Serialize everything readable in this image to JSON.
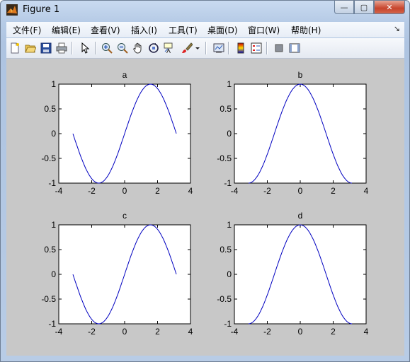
{
  "window": {
    "title": "Figure 1",
    "buttons": {
      "minimize": "—",
      "maximize": "▢",
      "close": "✕"
    }
  },
  "menubar": {
    "items": [
      "文件(F)",
      "编辑(E)",
      "查看(V)",
      "插入(I)",
      "工具(T)",
      "桌面(D)",
      "窗口(W)",
      "帮助(H)"
    ],
    "dock_arrow": "↘"
  },
  "toolbar": {
    "icons": [
      "new-figure-icon",
      "open-file-icon",
      "save-icon",
      "print-icon",
      "edit-plot-arrow-icon",
      "zoom-in-icon",
      "zoom-out-icon",
      "pan-hand-icon",
      "rotate-3d-icon",
      "data-cursor-icon",
      "brush-icon",
      "brush-dropdown-icon",
      "link-plot-icon",
      "insert-colorbar-icon",
      "insert-legend-icon",
      "hide-plot-tools-icon",
      "show-plot-tools-icon"
    ]
  },
  "colors": {
    "line": "#0000c0",
    "canvas": "#c8c8c8",
    "axes_bg": "#ffffff"
  },
  "chart_data": [
    {
      "type": "line",
      "title": "a",
      "function": "sin(x)",
      "x": [
        -3.14,
        -2.5,
        -2.0,
        -1.5708,
        -1.0,
        -0.5,
        0.0,
        0.5,
        1.0,
        1.5708,
        2.0,
        2.5,
        3.14
      ],
      "y": [
        0.0,
        -0.598,
        -0.909,
        -1.0,
        -0.841,
        -0.479,
        0.0,
        0.479,
        0.841,
        1.0,
        0.909,
        0.598,
        0.0
      ],
      "xlim": [
        -4,
        4
      ],
      "ylim": [
        -1,
        1
      ],
      "xticks": [
        "-4",
        "-2",
        "0",
        "2",
        "4"
      ],
      "yticks": [
        "1",
        "0.5",
        "0",
        "-0.5",
        "-1"
      ]
    },
    {
      "type": "line",
      "title": "b",
      "function": "cos(x)",
      "x": [
        -3.14,
        -2.5,
        -2.0,
        -1.5,
        -1.0,
        -0.5,
        0.0,
        0.5,
        1.0,
        1.5,
        2.0,
        2.5,
        3.14
      ],
      "y": [
        -1.0,
        -0.801,
        -0.416,
        0.071,
        0.54,
        0.878,
        1.0,
        0.878,
        0.54,
        0.071,
        -0.416,
        -0.801,
        -1.0
      ],
      "xlim": [
        -4,
        4
      ],
      "ylim": [
        -1,
        1
      ],
      "xticks": [
        "-4",
        "-2",
        "0",
        "2",
        "4"
      ],
      "yticks": [
        "1",
        "0.5",
        "0",
        "-0.5",
        "-1"
      ]
    },
    {
      "type": "line",
      "title": "c",
      "function": "sin(x)",
      "x": [
        -3.14,
        -2.5,
        -2.0,
        -1.5708,
        -1.0,
        -0.5,
        0.0,
        0.5,
        1.0,
        1.5708,
        2.0,
        2.5,
        3.14
      ],
      "y": [
        0.0,
        -0.598,
        -0.909,
        -1.0,
        -0.841,
        -0.479,
        0.0,
        0.479,
        0.841,
        1.0,
        0.909,
        0.598,
        0.0
      ],
      "xlim": [
        -4,
        4
      ],
      "ylim": [
        -1,
        1
      ],
      "xticks": [
        "-4",
        "-2",
        "0",
        "2",
        "4"
      ],
      "yticks": [
        "1",
        "0.5",
        "0",
        "-0.5",
        "-1"
      ]
    },
    {
      "type": "line",
      "title": "d",
      "function": "cos(x)",
      "x": [
        -3.14,
        -2.5,
        -2.0,
        -1.5,
        -1.0,
        -0.5,
        0.0,
        0.5,
        1.0,
        1.5,
        2.0,
        2.5,
        3.14
      ],
      "y": [
        -1.0,
        -0.801,
        -0.416,
        0.071,
        0.54,
        0.878,
        1.0,
        0.878,
        0.54,
        0.071,
        -0.416,
        -0.801,
        -1.0
      ],
      "xlim": [
        -4,
        4
      ],
      "ylim": [
        -1,
        1
      ],
      "xticks": [
        "-4",
        "-2",
        "0",
        "2",
        "4"
      ],
      "yticks": [
        "1",
        "0.5",
        "0",
        "-0.5",
        "-1"
      ]
    }
  ]
}
